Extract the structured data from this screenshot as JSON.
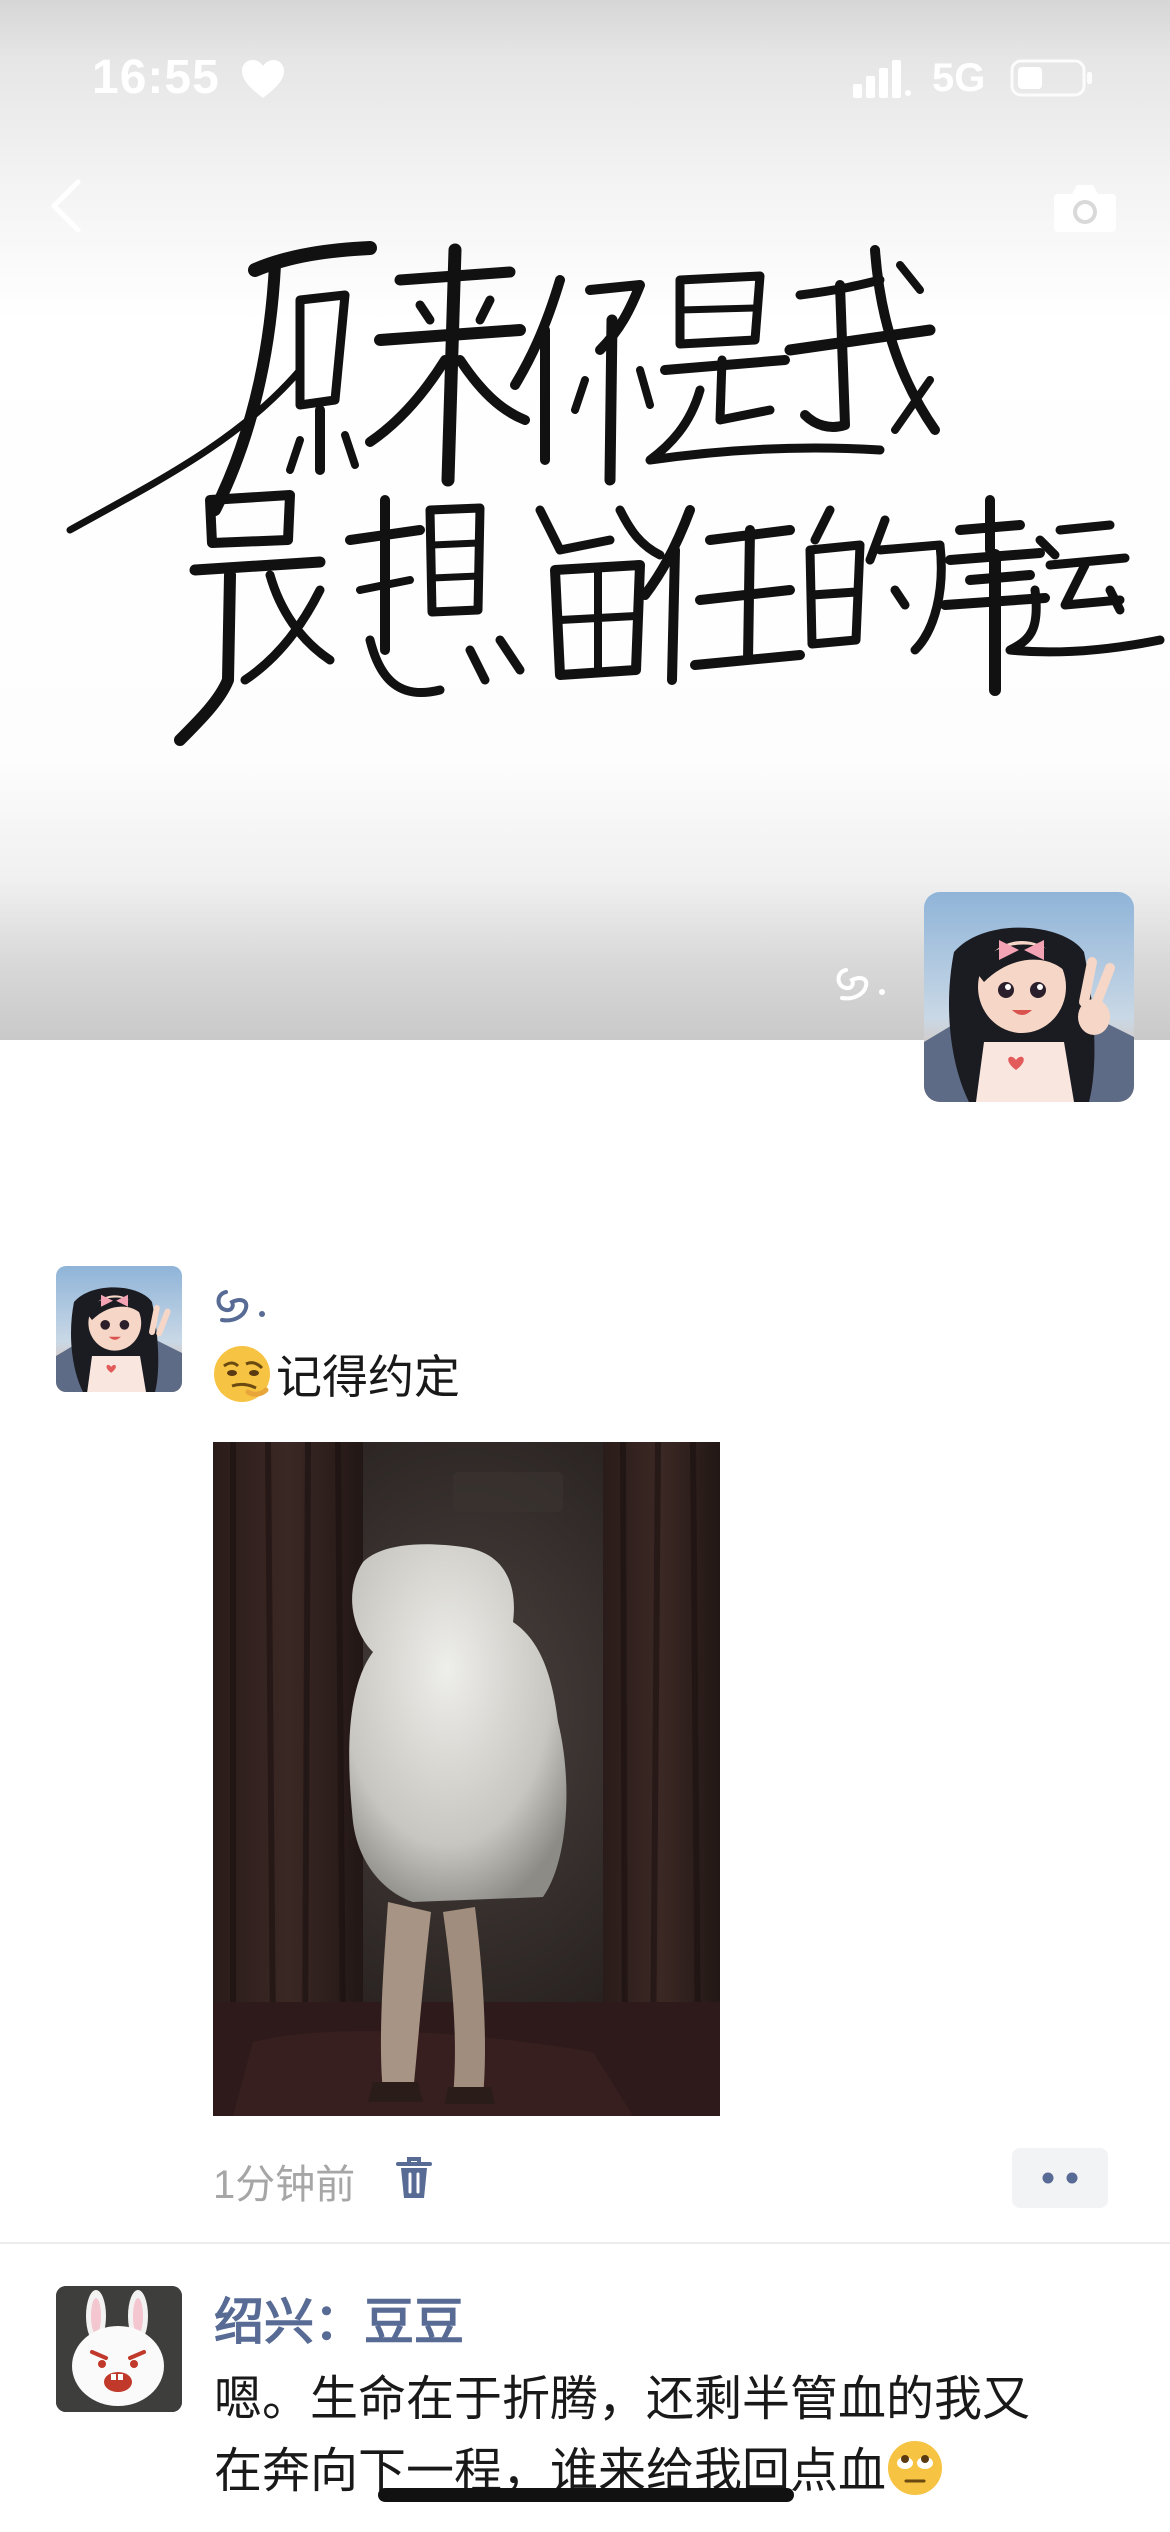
{
  "status_bar": {
    "time": "16:55",
    "network": "5G",
    "icons": [
      "heart-icon",
      "signal-icon",
      "battery-icon"
    ]
  },
  "header": {
    "back_icon": "chevron-left-icon",
    "camera_icon": "camera-icon"
  },
  "cover": {
    "calligraphy_text": "原来你是我最想留住的幸运"
  },
  "post": {
    "author_signature_icon": "signature-glyph-icon",
    "text": "记得约定",
    "emoji": "smirk-emoji-icon",
    "time": "1分钟前",
    "delete_icon": "trash-icon",
    "more_icon": "more-dots-icon"
  },
  "next_post": {
    "author": "绍兴：豆豆",
    "text_line1": "嗯。生命在于折腾，还剩半管血的我又",
    "text_line2": "在奔向下一程，谁来给我回点血",
    "emoji": "roll-eyes-emoji-icon"
  },
  "colors": {
    "link_blue": "#576b95",
    "text_gray": "#a6a6a6",
    "text_dark": "#191919"
  }
}
